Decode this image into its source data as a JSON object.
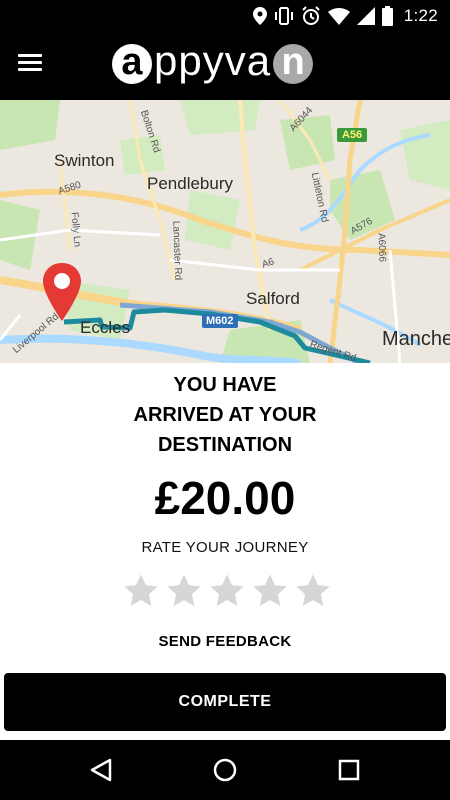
{
  "status_bar": {
    "time": "1:22",
    "icons": [
      "location-icon",
      "vibrate-icon",
      "alarm-icon",
      "wifi-icon",
      "signal-icon",
      "battery-icon"
    ]
  },
  "app_bar": {
    "menu_icon": "hamburger-menu-icon",
    "logo": {
      "first": "a",
      "middle": "ppyva",
      "last": "n"
    }
  },
  "map": {
    "towns": [
      "Swinton",
      "Pendlebury",
      "Salford",
      "Eccles",
      "Manche"
    ],
    "roads": [
      "Bolton Rd",
      "A6044",
      "A580",
      "Folly Ln",
      "Lancaster Rd",
      "Littleton Rd",
      "A576",
      "A6066",
      "A6",
      "Liverpool Rd",
      "Regent Rd"
    ],
    "motorway": "M602",
    "a_road": "A56",
    "colors": {
      "route": "#1e8a9e",
      "pin": "#e53935",
      "water": "#aadaff",
      "park": "#c8e6b2"
    }
  },
  "trip": {
    "arrived_lines": [
      "YOU HAVE",
      "ARRIVED AT YOUR",
      "DESTINATION"
    ],
    "fare": "£20.00",
    "rate_label": "RATE YOUR JOURNEY",
    "rating": 0,
    "max_rating": 5,
    "feedback_label": "SEND FEEDBACK",
    "complete_label": "COMPLETE"
  },
  "nav_bar": {
    "icons": [
      "back-icon",
      "home-icon",
      "recents-icon"
    ]
  }
}
